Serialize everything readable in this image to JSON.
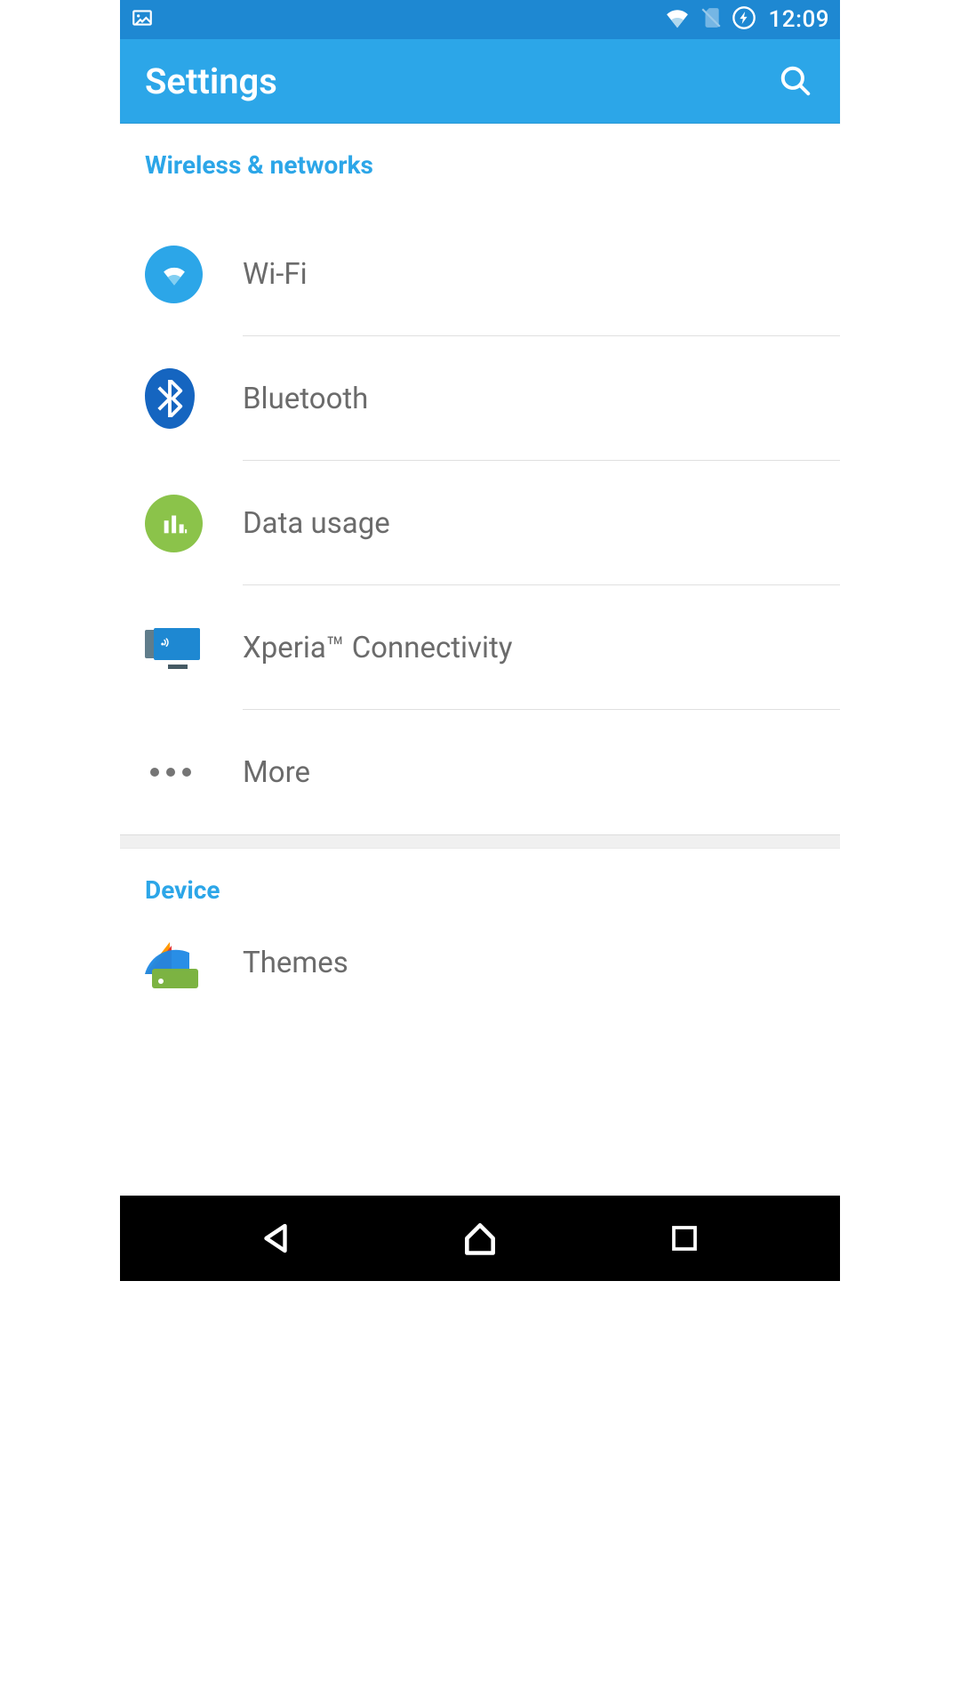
{
  "statusbar": {
    "time": "12:09",
    "icons": {
      "gallery": "picture-icon",
      "wifi": "wifi-icon",
      "sim": "no-sim-icon",
      "flash": "flash-circle-icon"
    }
  },
  "appbar": {
    "title": "Settings",
    "search_icon": "search-icon"
  },
  "sections": [
    {
      "title": "Wireless & networks",
      "items": [
        {
          "label": "Wi-Fi",
          "icon": "wifi-icon",
          "icon_bg": "#2ca6e8"
        },
        {
          "label": "Bluetooth",
          "icon": "bluetooth-icon",
          "icon_bg": "#1565c0"
        },
        {
          "label": "Data usage",
          "icon": "data-usage-icon",
          "icon_bg": "#8bc34a"
        },
        {
          "label": "Xperia™ Connectivity",
          "icon": "xperia-connectivity-icon",
          "icon_bg": "transparent"
        },
        {
          "label": "More",
          "icon": "more-icon",
          "icon_bg": "transparent"
        }
      ]
    },
    {
      "title": "Device",
      "items": [
        {
          "label": "Themes",
          "icon": "themes-icon",
          "icon_bg": "transparent"
        }
      ]
    }
  ],
  "colors": {
    "statusbar_bg": "#1e88d2",
    "appbar_bg": "#2ca6e8",
    "accent": "#2ca6e8"
  }
}
